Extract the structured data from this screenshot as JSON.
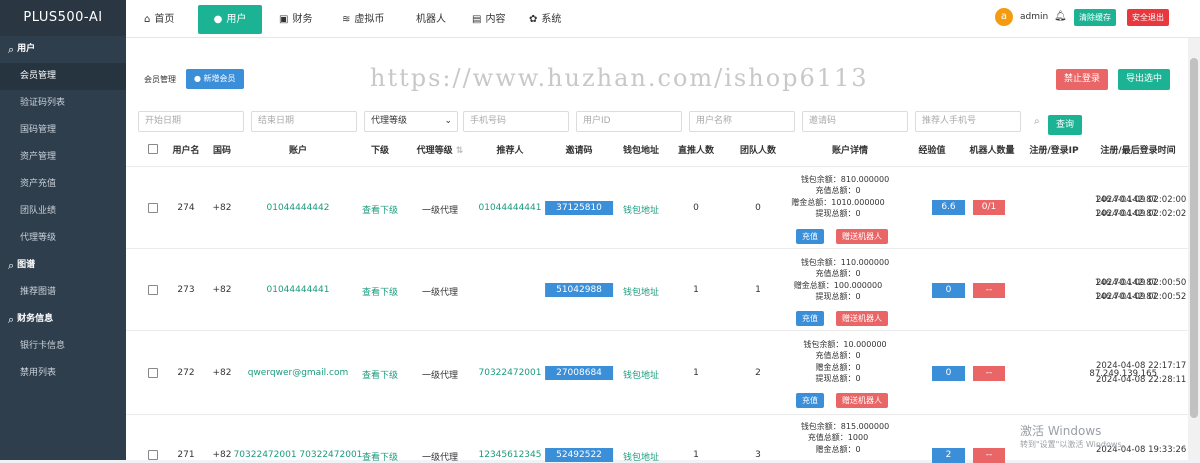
{
  "app": {
    "title": "PLUS500-AI"
  },
  "sidebar": {
    "groups": [
      {
        "label": "用户",
        "items": [
          "会员管理",
          "验证码列表",
          "国码管理",
          "资产管理",
          "资产充值",
          "团队业绩",
          "代理等级"
        ]
      },
      {
        "label": "图谱",
        "items": [
          "推荐图谱"
        ]
      },
      {
        "label": "财务信息",
        "items": [
          "银行卡信息",
          "禁用列表"
        ]
      }
    ]
  },
  "topnav": {
    "items": [
      "首页",
      "用户",
      "财务",
      "虚拟币",
      "机器人",
      "内容",
      "系统"
    ],
    "user": {
      "avatar": "a",
      "name": "admin"
    },
    "clear_cache": "清除缓存",
    "logout": "安全退出"
  },
  "page": {
    "title": "会员管理",
    "add_member": "新增会员",
    "watermark": "https://www.huzhan.com/ishop6113",
    "ban_login": "禁止登录",
    "export": "导出选中"
  },
  "filters": {
    "start_date": "开始日期",
    "end_date": "结束日期",
    "agent_level": "代理等级",
    "phone": "手机号码",
    "user_id": "用户ID",
    "user_name": "用户名称",
    "invite_code": "邀请码",
    "ref_phone": "推荐人手机号",
    "query": "查询"
  },
  "table": {
    "headers": [
      "用户名",
      "国码",
      "账户",
      "下级",
      "代理等级",
      "推荐人",
      "邀请码",
      "钱包地址",
      "直推人数",
      "团队人数",
      "账户详情",
      "经验值",
      "机器人数量",
      "注册/登录IP",
      "注册/最后登录时间"
    ],
    "detail_labels": {
      "wallet": "钱包余额",
      "recharge": "充值总额",
      "gift": "赠金总额",
      "withdraw": "提现总额"
    },
    "action_recharge": "充值",
    "action_gift_robot": "赠送机器人",
    "rows": [
      {
        "id": "274",
        "code": "+82",
        "account": "01044444442",
        "sub": "查看下级",
        "level": "一级代理",
        "ref": "01044444441",
        "invite": "37125810",
        "wallet": "钱包地址",
        "direct": "0",
        "team": "0",
        "d1": "钱包余额：810.000000",
        "d2": "充值总额：0",
        "d3": "赠金总额：1010.000000",
        "d4": "提现总额：0",
        "exp": "6.6",
        "robots": "0/1",
        "ip1": "146.70.142.87",
        "ip2": "146.70.142.87",
        "t1": "2024-04-09 02:02:00",
        "t2": "2024-04-09 02:02:02"
      },
      {
        "id": "273",
        "code": "+82",
        "account": "01044444441",
        "sub": "查看下级",
        "level": "一级代理",
        "ref": "",
        "invite": "51042988",
        "wallet": "钱包地址",
        "direct": "1",
        "team": "1",
        "d1": "钱包余额：110.000000",
        "d2": "充值总额：0",
        "d3": "赠金总额：100.000000",
        "d4": "提现总额：0",
        "exp": "0",
        "robots": "--",
        "ip1": "146.70.142.87",
        "ip2": "146.70.142.87",
        "t1": "2024-04-09 02:00:50",
        "t2": "2024-04-09 02:00:52"
      },
      {
        "id": "272",
        "code": "+82",
        "account": "qwerqwer@gmail.com",
        "sub": "查看下级",
        "level": "一级代理",
        "ref": "70322472001",
        "invite": "27008684",
        "wallet": "钱包地址",
        "direct": "1",
        "team": "2",
        "d1": "钱包余额：10.000000",
        "d2": "充值总额：0",
        "d3": "赠金总额：0",
        "d4": "提现总额：0",
        "exp": "0",
        "robots": "--",
        "ip1": "87.249.139.165",
        "ip2": "",
        "t1": "2024-04-08 22:17:17",
        "t2": "2024-04-08 22:28:11"
      },
      {
        "id": "271",
        "code": "+82",
        "account": "70322472001 70322472001",
        "sub": "查看下级",
        "level": "一级代理",
        "ref": "12345612345",
        "invite": "52492522",
        "wallet": "钱包地址",
        "direct": "1",
        "team": "3",
        "d1": "钱包余额：815.000000",
        "d2": "充值总额：1000",
        "d3": "赠金总额：0",
        "d4": "",
        "exp": "2",
        "robots": "--",
        "ip1": "",
        "ip2": "",
        "t1": "2024-04-08 19:33:26",
        "t2": ""
      }
    ]
  },
  "os_watermark": {
    "line1": "激活 Windows",
    "line2": "转到\"设置\"以激活 Windows。"
  },
  "colors": {
    "sidebar": "#2f3e4d",
    "accent": "#1bb394",
    "blue": "#3b8ed8",
    "red": "#e96566"
  }
}
